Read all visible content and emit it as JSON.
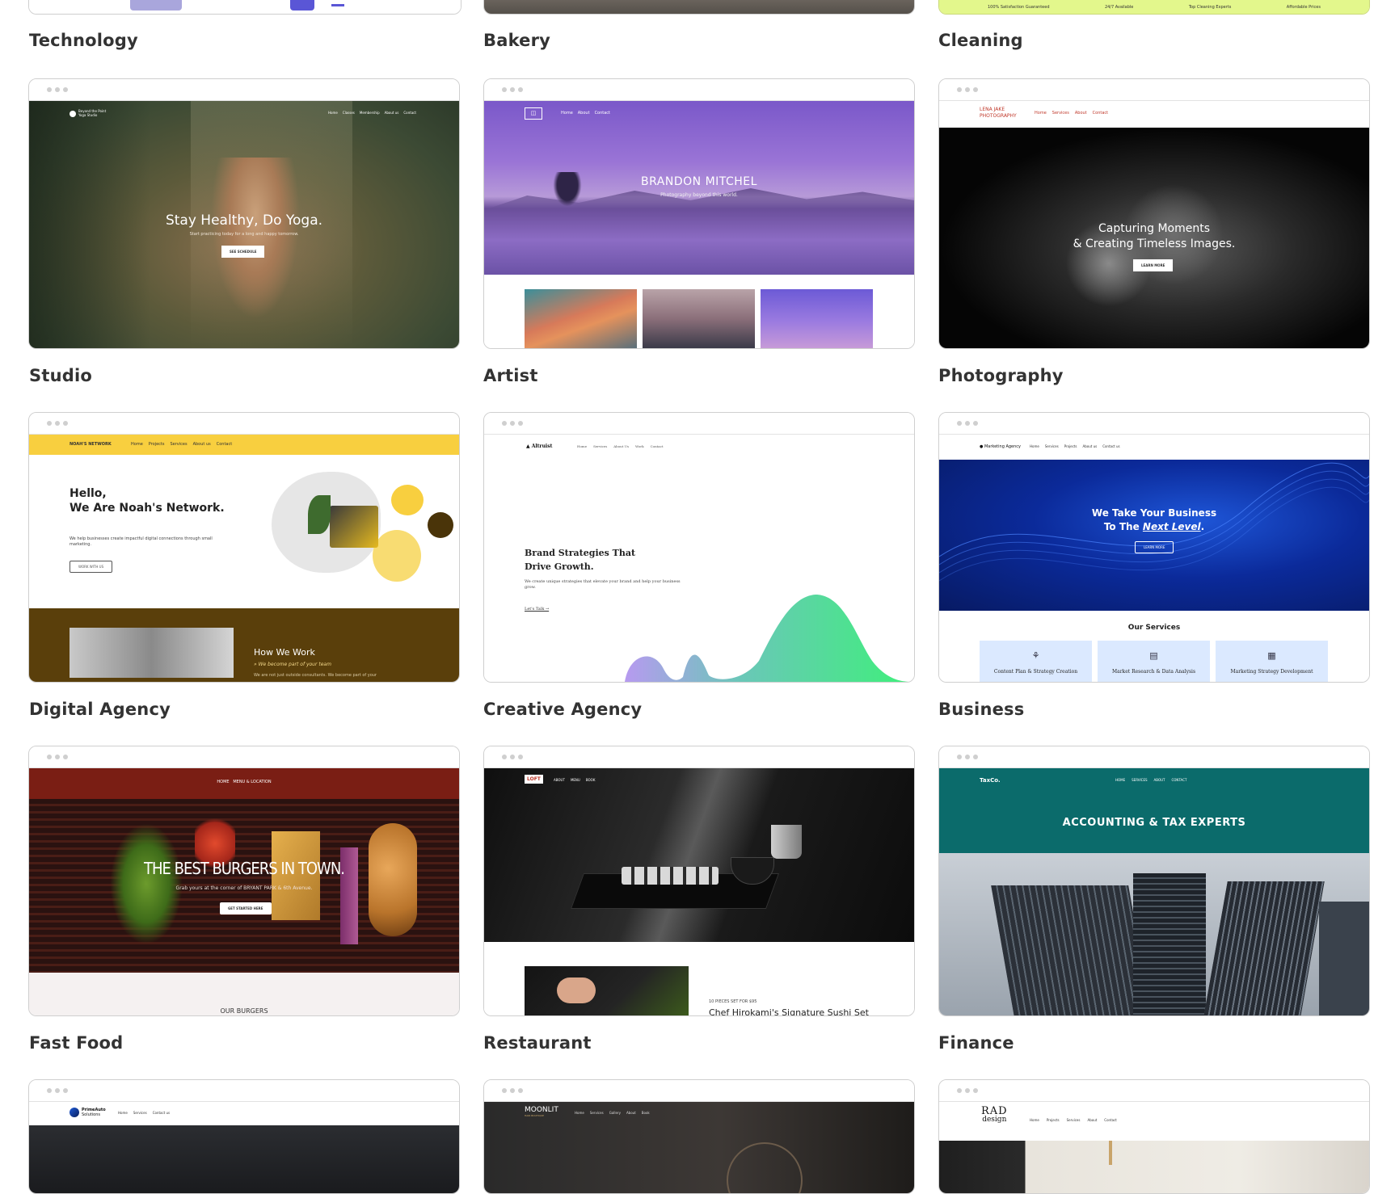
{
  "captions": {
    "technology": "Technology",
    "bakery": "Bakery",
    "cleaning": "Cleaning",
    "studio": "Studio",
    "artist": "Artist",
    "photography": "Photography",
    "digital_agency": "Digital Agency",
    "creative_agency": "Creative Agency",
    "business": "Business",
    "fast_food": "Fast Food",
    "restaurant": "Restaurant",
    "finance": "Finance"
  },
  "cleaning_strip": [
    "100% Satisfaction Guaranteed",
    "24/7 Available",
    "Top Cleaning Experts",
    "Affordable Prices"
  ],
  "studio": {
    "brand": "Beyond the Point",
    "brand_sub": "Yoga Studio",
    "nav": [
      "Home",
      "Classes",
      "Membership",
      "About us",
      "Contact"
    ],
    "headline": "Stay Healthy, Do Yoga.",
    "sub": "Start practicing today for a long and happy tomorrow.",
    "button": "SEE SCHEDULE"
  },
  "artist": {
    "nav": [
      "Home",
      "About",
      "Contact"
    ],
    "headline": "BRANDON MITCHEL",
    "sub": "Photography beyond this world."
  },
  "photography": {
    "brand_line1": "LENA JAKE",
    "brand_line2": "PHOTOGRAPHY",
    "nav": [
      "Home",
      "Services",
      "About",
      "Contact"
    ],
    "headline_1": "Capturing Moments",
    "headline_2": "& Creating Timeless Images.",
    "button": "LEARN MORE"
  },
  "digital_agency": {
    "brand": "NOAH'S NETWORK",
    "nav": [
      "Home",
      "Projects",
      "Services",
      "About us",
      "Contact"
    ],
    "hello": "Hello,",
    "headline": "We Are Noah's Network.",
    "body": "We help businesses create impactful digital connections through small marketing.",
    "button": "WORK WITH US",
    "section_title": "How We Work",
    "section_sub": "» We become part of your team",
    "section_body": "We are not just outside consultants. We become part of your"
  },
  "creative_agency": {
    "brand": "Altruist",
    "nav": [
      "Home",
      "Services",
      "About Us",
      "Work",
      "Contact"
    ],
    "headline_1": "Brand Strategies That",
    "headline_2": "Drive Growth.",
    "body": "We create unique strategies that elevate your brand and help your business grow.",
    "link": "Let's Talk →"
  },
  "business": {
    "brand": "Marketing Agency",
    "nav": [
      "Home",
      "Services",
      "Projects",
      "About us",
      "Contact us"
    ],
    "headline_1": "We Take Your Business",
    "headline_2": "To The",
    "headline_em": "Next Level",
    "button": "LEARN MORE",
    "services_title": "Our Services",
    "services": [
      "Content Plan & Strategy Creation",
      "Market Research & Data Analysis",
      "Marketing Strategy Development"
    ]
  },
  "fast_food": {
    "nav": "HOME   MENU & LOCATION",
    "headline": "THE BEST BURGERS IN TOWN.",
    "sub": "Grab yours at the corner of BRYANT PARK & 6th Avenue.",
    "button": "GET STARTED HERE",
    "section": "OUR BURGERS"
  },
  "restaurant": {
    "logo": "LOFT",
    "nav": [
      "ABOUT",
      "MENU",
      "BOOK"
    ],
    "item_small": "10 PIECES SET FOR $95",
    "item_title": "Chef Hirokami's Signature Sushi Set"
  },
  "finance": {
    "brand": "TaxCo.",
    "nav": [
      "HOME",
      "SERVICES",
      "ABOUT",
      "CONTACT"
    ],
    "headline": "ACCOUNTING & TAX EXPERTS"
  },
  "row5": {
    "auto_brand": "PrimeAuto",
    "auto_brand_sub": "Solutions",
    "auto_nav": [
      "Home",
      "Services",
      "Contact us"
    ],
    "moon_brand": "MOONLIT",
    "moon_sub": "HAIR BOUTIQUE",
    "moon_nav": [
      "Home",
      "Services",
      "Gallery",
      "About",
      "Book"
    ],
    "rad_brand": "RAD",
    "rad_sub": "design",
    "rad_nav": [
      "Home",
      "Projects",
      "Services",
      "About",
      "Contact"
    ]
  },
  "colors": {
    "yellow": "#f8cf3f",
    "brown": "#5a3f0b",
    "teal": "#0b6b6b",
    "burger_red": "#7a1e14",
    "cleaning_green": "#e3f78c",
    "accent_purple": "#5a56d6"
  }
}
